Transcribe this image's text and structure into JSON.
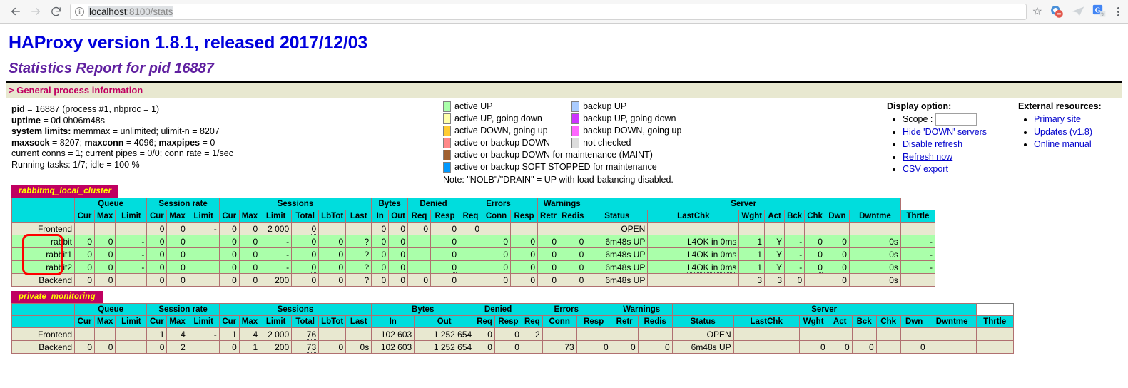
{
  "browser": {
    "back_icon": "back-arrow",
    "forward_icon": "forward-arrow",
    "reload_icon": "reload",
    "info_glyph": "i",
    "url_host": "localhost",
    "url_rest": ":8100/stats",
    "star_glyph": "☆"
  },
  "page": {
    "title": "HAProxy version 1.8.1, released 2017/12/03",
    "subtitle": "Statistics Report for pid 16887",
    "section_header": "> General process information"
  },
  "process": {
    "pid_label": "pid",
    "pid_value": " = 16887 (process #1, nbproc = 1)",
    "uptime_label": "uptime",
    "uptime_value": " = 0d 0h06m48s",
    "limits_label": "system limits:",
    "limits_value": " memmax = unlimited; ulimit-n = 8207",
    "maxsock_label": "maxsock",
    "maxsock_value": " = 8207; ",
    "maxconn_label": "maxconn",
    "maxconn_value": " = 4096; ",
    "maxpipes_label": "maxpipes",
    "maxpipes_value": " = 0",
    "conns_line": "current conns = 1; current pipes = 0/0; conn rate = 1/sec",
    "tasks_line": "Running tasks: 1/7; idle = 100 %"
  },
  "legend": {
    "items": [
      {
        "label": "active UP",
        "color": "#aaffaa"
      },
      {
        "label": "backup UP",
        "color": "#aaccff"
      },
      {
        "label": "active UP, going down",
        "color": "#ffffaa"
      },
      {
        "label": "backup UP, going down",
        "color": "#cc33ff"
      },
      {
        "label": "active DOWN, going up",
        "color": "#ffcc33"
      },
      {
        "label": "backup DOWN, going up",
        "color": "#ff66ff"
      },
      {
        "label": "active or backup DOWN",
        "color": "#ff8888"
      },
      {
        "label": "not checked",
        "color": "#dddddd"
      }
    ],
    "wide_items": [
      {
        "label": "active or backup DOWN for maintenance (MAINT)",
        "color": "#a06030"
      },
      {
        "label": "active or backup SOFT STOPPED for maintenance",
        "color": "#0099ff"
      }
    ],
    "note": "Note: \"NOLB\"/\"DRAIN\" = UP with load-balancing disabled."
  },
  "display_option": {
    "title": "Display option:",
    "scope_label": "Scope :",
    "scope_value": "",
    "links": [
      "Hide 'DOWN' servers",
      "Disable refresh",
      "Refresh now",
      "CSV export"
    ]
  },
  "external_resources": {
    "title": "External resources:",
    "links": [
      "Primary site",
      "Updates (v1.8)",
      "Online manual"
    ]
  },
  "table_headers": {
    "groups": [
      {
        "label": "",
        "span": 1
      },
      {
        "label": "Queue",
        "span": 3
      },
      {
        "label": "Session rate",
        "span": 3
      },
      {
        "label": "Sessions",
        "span": 6
      },
      {
        "label": "Bytes",
        "span": 2
      },
      {
        "label": "Denied",
        "span": 2
      },
      {
        "label": "Errors",
        "span": 3
      },
      {
        "label": "Warnings",
        "span": 2
      },
      {
        "label": "Server",
        "span": 8
      }
    ],
    "columns": [
      "",
      "Cur",
      "Max",
      "Limit",
      "Cur",
      "Max",
      "Limit",
      "Cur",
      "Max",
      "Limit",
      "Total",
      "LbTot",
      "Last",
      "In",
      "Out",
      "Req",
      "Resp",
      "Req",
      "Conn",
      "Resp",
      "Retr",
      "Redis",
      "Status",
      "LastChk",
      "Wght",
      "Act",
      "Bck",
      "Chk",
      "Dwn",
      "Dwntme",
      "Thrtle"
    ]
  },
  "proxies": [
    {
      "name": "rabbitmq_local_cluster",
      "rows": [
        {
          "kind": "frontend",
          "cells": [
            "Frontend",
            "",
            "",
            "",
            "0",
            "0",
            "-",
            "0",
            "0",
            "2 000",
            "0",
            "",
            "",
            "0",
            "0",
            "0",
            "0",
            "0",
            "",
            "",
            "",
            "",
            "OPEN",
            "",
            "",
            "",
            "",
            "",
            "",
            "",
            ""
          ]
        },
        {
          "kind": "server",
          "cells": [
            "rabbit",
            "0",
            "0",
            "-",
            "0",
            "0",
            "",
            "0",
            "0",
            "-",
            "0",
            "0",
            "?",
            "0",
            "0",
            "",
            "0",
            "",
            "0",
            "0",
            "0",
            "0",
            "6m48s UP",
            "L4OK in 0ms",
            "1",
            "Y",
            "-",
            "0",
            "0",
            "0s",
            "-"
          ]
        },
        {
          "kind": "server",
          "cells": [
            "rabbit1",
            "0",
            "0",
            "-",
            "0",
            "0",
            "",
            "0",
            "0",
            "-",
            "0",
            "0",
            "?",
            "0",
            "0",
            "",
            "0",
            "",
            "0",
            "0",
            "0",
            "0",
            "6m48s UP",
            "L4OK in 0ms",
            "1",
            "Y",
            "-",
            "0",
            "0",
            "0s",
            "-"
          ]
        },
        {
          "kind": "server",
          "cells": [
            "rabbit2",
            "0",
            "0",
            "-",
            "0",
            "0",
            "",
            "0",
            "0",
            "-",
            "0",
            "0",
            "?",
            "0",
            "0",
            "",
            "0",
            "",
            "0",
            "0",
            "0",
            "0",
            "6m48s UP",
            "L4OK in 0ms",
            "1",
            "Y",
            "-",
            "0",
            "0",
            "0s",
            "-"
          ]
        },
        {
          "kind": "backend",
          "cells": [
            "Backend",
            "0",
            "0",
            "",
            "0",
            "0",
            "",
            "0",
            "0",
            "200",
            "0",
            "0",
            "?",
            "0",
            "0",
            "0",
            "0",
            "",
            "0",
            "0",
            "0",
            "0",
            "6m48s UP",
            "",
            "3",
            "3",
            "0",
            "",
            "0",
            "0s",
            ""
          ]
        }
      ]
    },
    {
      "name": "private_monitoring",
      "rows": [
        {
          "kind": "frontend",
          "cells": [
            "Frontend",
            "",
            "",
            "",
            "1",
            "4",
            "-",
            "1",
            "4",
            "2 000",
            "76",
            "",
            "",
            "102 603",
            "1 252 654",
            "0",
            "0",
            "2",
            "",
            "",
            "",
            "",
            "OPEN",
            "",
            "",
            "",
            "",
            "",
            "",
            "",
            ""
          ]
        },
        {
          "kind": "backend",
          "cells": [
            "Backend",
            "0",
            "0",
            "",
            "0",
            "2",
            "",
            "0",
            "1",
            "200",
            "73",
            "0",
            "0s",
            "102 603",
            "1 252 654",
            "0",
            "0",
            "",
            "73",
            "0",
            "0",
            "0",
            "6m48s UP",
            "",
            "0",
            "0",
            "0",
            "",
            "0",
            "",
            ""
          ]
        }
      ]
    }
  ],
  "annotation": {
    "shape": "rounded-rectangle",
    "color": "#ff0000",
    "target": "server-name-cells"
  }
}
